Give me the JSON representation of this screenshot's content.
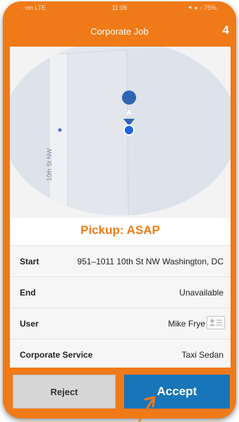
{
  "status_bar": {
    "carrier": "∙ᐧon  LTE",
    "time": "11:06",
    "right": "⯇ ● ▫ 75%"
  },
  "navbar": {
    "title": "Corporate Job",
    "count": "4"
  },
  "map": {
    "street_label": "10th St NW",
    "pin_letter": "A"
  },
  "pickup": {
    "title": "Pickup: ASAP"
  },
  "details": [
    {
      "label": "Start",
      "value": "951–1011 10th St NW Washington, DC"
    },
    {
      "label": "End",
      "value": "Unavailable"
    },
    {
      "label": "User",
      "value": "Mike Frye"
    },
    {
      "label": "Corporate Service",
      "value": "Taxi Sedan"
    }
  ],
  "actions": {
    "reject_label": "Reject",
    "accept_label": "Accept"
  },
  "colors": {
    "brand_orange": "#ef7a17",
    "accept_blue": "#1775b9",
    "reject_gray": "#d6d6d6"
  }
}
